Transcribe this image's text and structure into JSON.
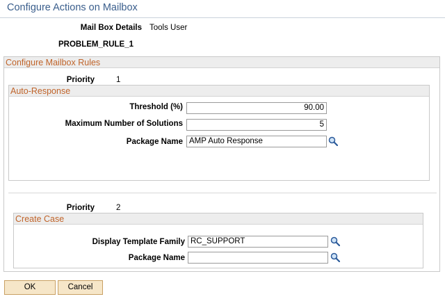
{
  "page": {
    "title": "Configure Actions on Mailbox"
  },
  "mailbox": {
    "details_label": "Mail Box Details",
    "details_value": "Tools User",
    "rule_name": "PROBLEM_RULE_1"
  },
  "rules_section": {
    "title": "Configure Mailbox Rules"
  },
  "rule1": {
    "priority_label": "Priority",
    "priority_value": "1",
    "group_title": "Auto-Response",
    "threshold_label": "Threshold (%)",
    "threshold_value": "90.00",
    "max_solutions_label": "Maximum Number of Solutions",
    "max_solutions_value": "5",
    "package_label": "Package Name",
    "package_value": "AMP Auto Response"
  },
  "rule2": {
    "priority_label": "Priority",
    "priority_value": "2",
    "group_title": "Create Case",
    "template_family_label": "Display Template Family",
    "template_family_value": "RC_SUPPORT",
    "package_label": "Package Name",
    "package_value": ""
  },
  "buttons": {
    "ok_label": "OK",
    "cancel_label": "Cancel"
  },
  "colors": {
    "title": "#3a5e8c",
    "group_header_text": "#c0642a",
    "button_bg": "#f6e6c8"
  }
}
